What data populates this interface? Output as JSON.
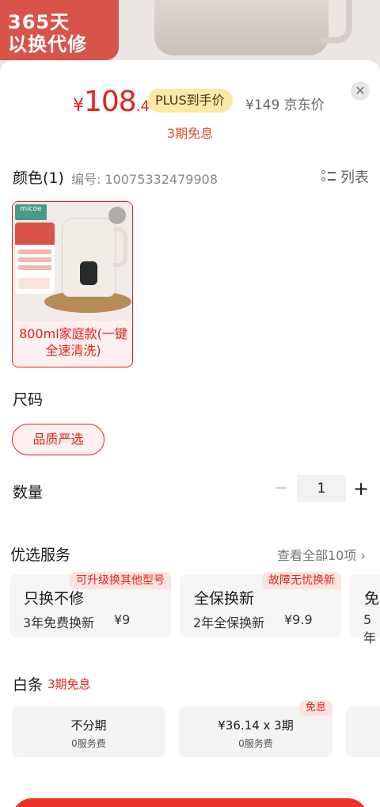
{
  "background": {
    "promo_line1": "365天",
    "promo_line2": "以换代修"
  },
  "price": {
    "yen": "¥",
    "integer": "108",
    "decimal": ".4",
    "plus_label": "PLUS到手价",
    "jd_price": "¥149 京东价",
    "installment": "3期免息"
  },
  "color": {
    "title": "颜色(1)",
    "serial": "编号: 10075332479908",
    "list_label": "列表",
    "variant": {
      "brand": "micoe",
      "label": "800ml家庭款(一键全速清洗)"
    }
  },
  "size": {
    "title": "尺码",
    "option": "品质严选"
  },
  "quantity": {
    "title": "数量",
    "minus": "−",
    "value": "1",
    "plus": "+"
  },
  "services": {
    "title": "优选服务",
    "view_all": "查看全部10项 ›",
    "items": [
      {
        "badge": "可升级换其他型号",
        "name": "只换不修",
        "desc": "3年免费换新",
        "price": "¥9"
      },
      {
        "badge": "故障无忧换新",
        "name": "全保换新",
        "desc": "2年全保换新",
        "price": "¥9.9"
      },
      {
        "badge": "",
        "name": "免",
        "desc": "5年",
        "price": ""
      }
    ]
  },
  "baitiao": {
    "title": "白条",
    "tag": "3期免息",
    "options": [
      {
        "badge": "",
        "line1": "不分期",
        "line2": "0服务费"
      },
      {
        "badge": "免息",
        "line1": "¥36.14 x 3期",
        "line2": "0服务费"
      },
      {
        "badge": "",
        "line1": "",
        "line2": ""
      }
    ]
  },
  "colors": {
    "accent": "#e2231a",
    "plus_pill": "#fbe9a8"
  }
}
